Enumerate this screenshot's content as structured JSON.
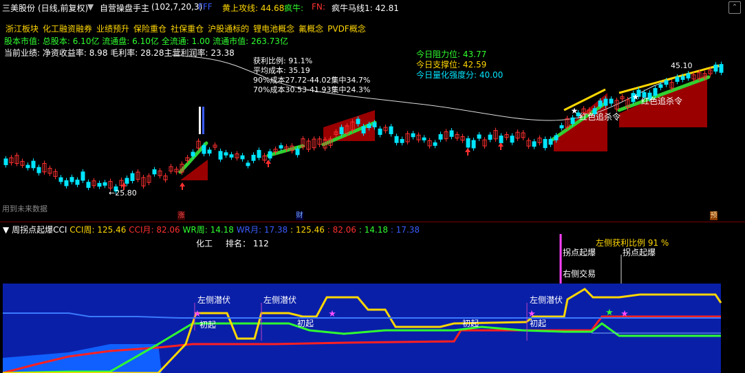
{
  "header": {
    "stock_name": "三美股份",
    "period": "(日线,前复权)",
    "indicator_name": "自营操盘手主",
    "indicator_params": "(102,7,20,3)",
    "fff": "FFF",
    "yellow_line_label": "黄上攻线: 44.68",
    "crazy_bull_label": "疯牛:",
    "fn_label": "FN:",
    "crazy_horse_label": "疯牛马线1: 42.81"
  },
  "concepts": [
    "浙江板块",
    "化工融资融券",
    "业绩预升",
    "保险重仓",
    "社保重仓",
    "沪股通标的",
    "锂电池概念",
    "氟概念",
    "PVDF概念"
  ],
  "equity": {
    "prefix": "股本市值:",
    "total": "总股本: 6.10亿",
    "float": "流通盘: 6.10亿",
    "all_float": "全流通: 1.00",
    "float_value": "流通市值: 263.73亿"
  },
  "performance": {
    "prefix": "当前业绩:",
    "roe": "净资收益率: 8.98",
    "gross_margin": "毛利率: 28.28",
    "main_margin": "主营利润率: 23.38"
  },
  "cost_info": {
    "profit_ratio": "获利比例: 91.1%",
    "avg_cost": "平均成本: 35.19",
    "cost90": "90%成本27.72-44.02集中34.7%",
    "cost70": "70%成本30.53-41.93集中24.3%"
  },
  "levels": {
    "resistance": "今日阻力位:  43.77",
    "support": "今日支撑位:  42.59",
    "strength": "今日量化强度分:  40.00"
  },
  "price_annotations": {
    "low": "←25.80",
    "high": "45.10",
    "red_chase_1": "红色追杀令",
    "red_chase_2": "红色追杀令",
    "future_data": "用到未来数据"
  },
  "markers": {
    "zhang": "涨",
    "cai": "财",
    "yu": "预"
  },
  "lower_header": {
    "indicator_name": "周拐点起爆CCI",
    "cci_week": "CCI周: 125.46",
    "cci_month": "CCI月: 82.06",
    "wr_week": "WR周: 14.18",
    "wr_month": "WR月: 17.38",
    "v1": ": 125.46",
    "v2": ": 82.06",
    "v3": ": 14.18",
    "v4": ": 17.38"
  },
  "industry": {
    "name": "化工",
    "rank": "排名：  112"
  },
  "lower_annotations": {
    "left_profit": "左侧获利比例 91 %",
    "turn_point_1": "拐点起爆",
    "turn_point_2": "拐点起爆",
    "right_trade": "右侧交易",
    "left_lurk_1": "左侧潜伏",
    "left_lurk_2": "左侧潜伏",
    "left_lurk_3": "左侧潜伏",
    "start_1": "初起",
    "start_2": "初起",
    "start_3": "初起",
    "start_4": "初起"
  },
  "colors": {
    "up": "#ff3030",
    "down": "#00e5ff",
    "yellow": "#ffd700",
    "green": "#30ff30",
    "blue_fill": "#0a1fa8",
    "bright_blue": "#1060ff",
    "magenta": "#ff4cff"
  },
  "chart_data": [
    {
      "type": "candlestick",
      "title": "",
      "price_range": [
        25.8,
        45.1
      ],
      "annotated_low": 25.8,
      "annotated_high": 45.1
    },
    {
      "type": "line",
      "title": "",
      "series": [
        {
          "name": "CCI周",
          "value": 125.46
        },
        {
          "name": "CCI月",
          "value": 82.06
        },
        {
          "name": "WR周",
          "value": 14.18
        },
        {
          "name": "WR月",
          "value": 17.38
        }
      ]
    }
  ]
}
